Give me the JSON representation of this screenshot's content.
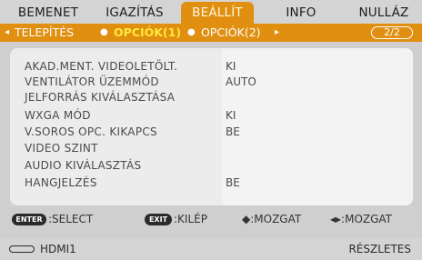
{
  "top_tabs": [
    "BEMENET",
    "IGAZÍTÁS",
    "BEÁLLÍT",
    "INFO",
    "NULLÁZ"
  ],
  "sub_tabs": {
    "left_arrow": "◂",
    "items": [
      "TELEPÍTÉS",
      "OPCIÓK(1)",
      "OPCIÓK(2)"
    ],
    "right_arrow": "▸",
    "page_indicator": "2/2"
  },
  "settings": [
    {
      "label": "AKAD.MENT. VIDEOLETÖLT.",
      "value": "KI"
    },
    {
      "label": "VENTILÁTOR ÜZEMMÓD",
      "value": "AUTO"
    },
    {
      "label": "JELFORRÁS KIVÁLASZTÁSA",
      "value": ""
    },
    {
      "label": "WXGA MÓD",
      "value": "KI"
    },
    {
      "label": "V.SOROS OPC. KIKAPCS",
      "value": "BE"
    },
    {
      "label": "VIDEO SZINT",
      "value": ""
    },
    {
      "label": "AUDIO KIVÁLASZTÁS",
      "value": ""
    },
    {
      "label": "HANGJELZÉS",
      "value": "BE"
    }
  ],
  "footer": {
    "enter_key": "ENTER",
    "select_text": ":SELECT",
    "exit_key": "EXIT",
    "exit_text": ":KILÉP",
    "move_v_text": "◆:MOZGAT",
    "move_h_text": "◂▸:MOZGAT"
  },
  "status": {
    "source": "HDMI1",
    "details": "RÉSZLETES",
    "input_icon": "input-connector-icon"
  },
  "colors": {
    "accent": "#e08f10",
    "highlight": "#ffe93d"
  }
}
